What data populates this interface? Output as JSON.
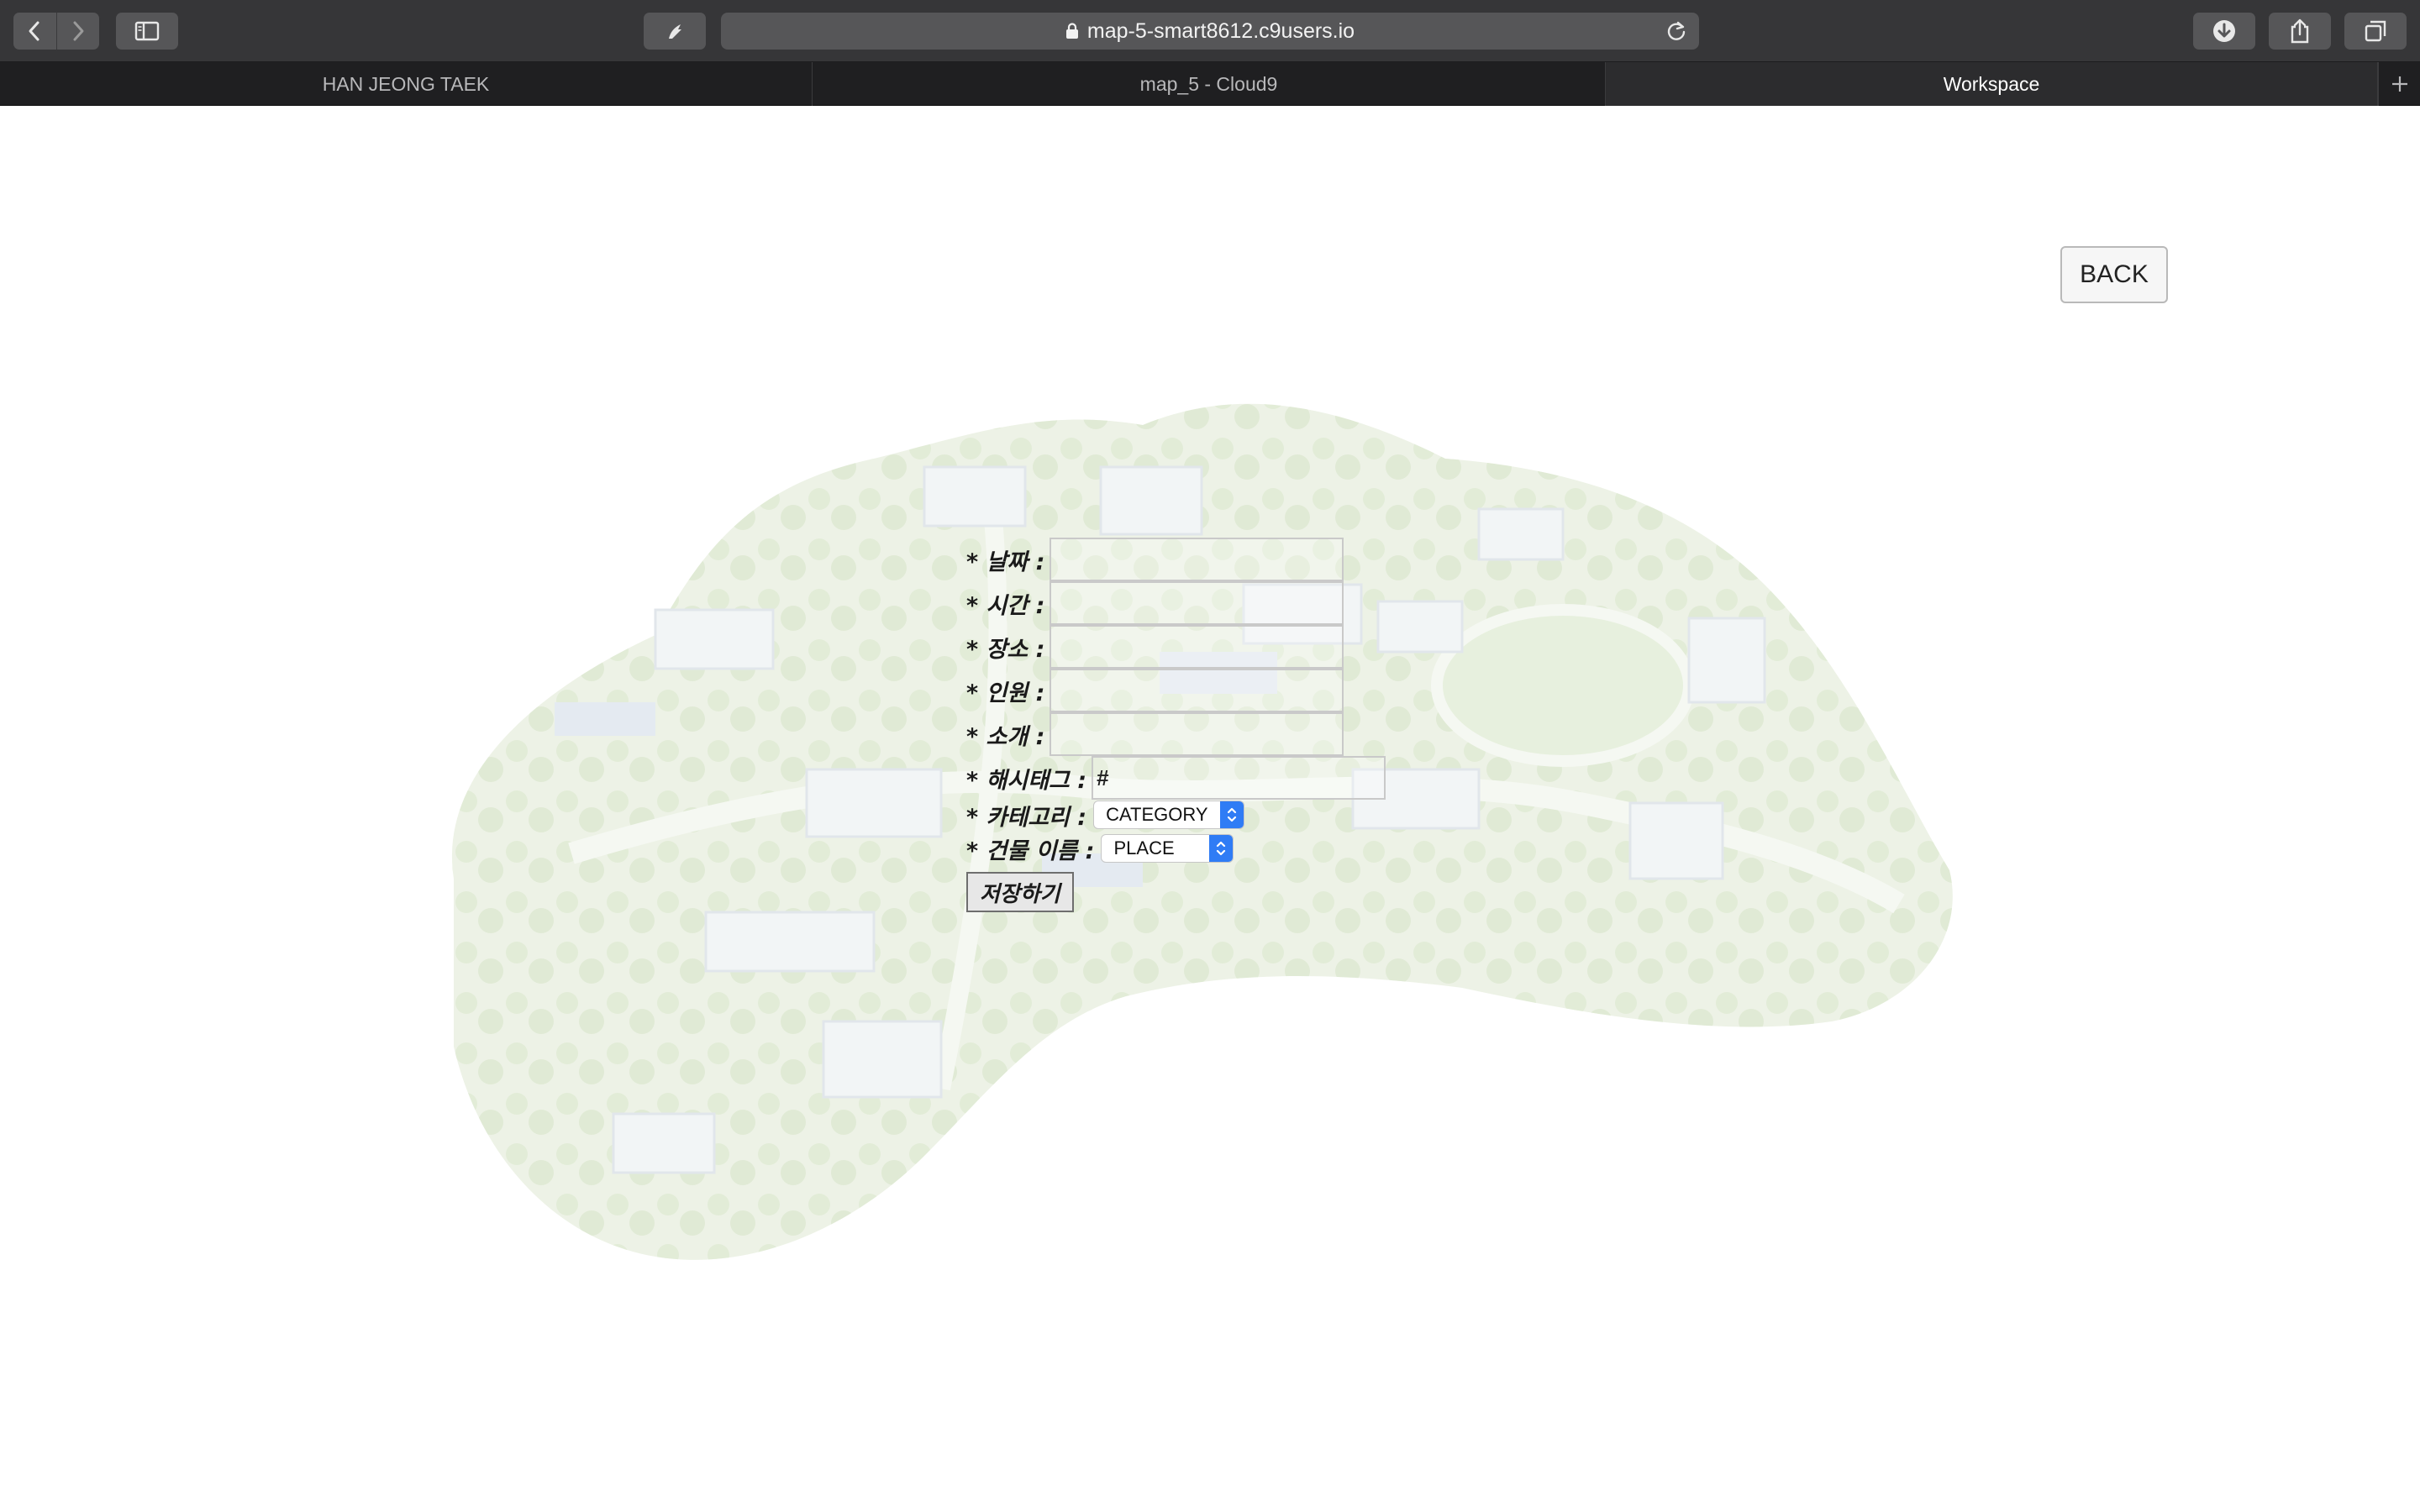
{
  "browser": {
    "url": "map-5-smart8612.c9users.io",
    "tabs": [
      {
        "label": "HAN JEONG TAEK",
        "active": false
      },
      {
        "label": "map_5 - Cloud9",
        "active": false
      },
      {
        "label": "Workspace",
        "active": true
      }
    ],
    "icons": {
      "back": "chevron-left-icon",
      "forward": "chevron-right-icon",
      "sidebar": "sidebar-icon",
      "extension": "extension-icon",
      "lock": "lock-icon",
      "reload": "reload-icon",
      "downloads": "download-icon",
      "share": "share-icon",
      "tabs": "tab-overview-icon",
      "new_tab": "plus-icon"
    }
  },
  "page": {
    "back_label": "BACK",
    "form": {
      "date_label": "* 날짜 :",
      "time_label": "* 시간 :",
      "place_label": "* 장소 :",
      "people_label": "* 인원 :",
      "intro_label": "* 소개 :",
      "hashtag_label": "* 해시태그 :",
      "hashtag_value": "#",
      "category_label": "* 카테고리 :",
      "category_selected": "CATEGORY",
      "building_label": "* 건물 이름 :",
      "building_selected": "PLACE",
      "save_label": "저장하기"
    },
    "colors": {
      "chrome_dark": "#363638",
      "tabbar": "#1f1f21",
      "select_accent": "#2f7cf5",
      "map_green": "#a9c98a"
    }
  }
}
